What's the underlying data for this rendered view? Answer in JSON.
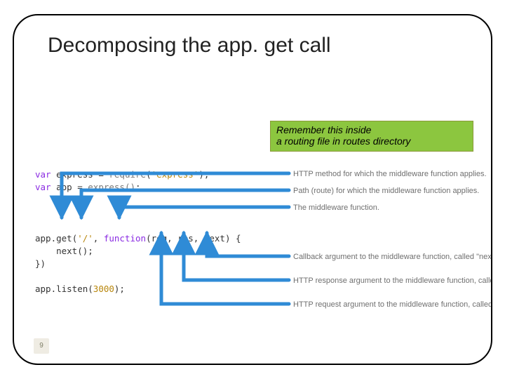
{
  "title": "Decomposing the app. get call",
  "callout": {
    "line1": "Remember this inside",
    "line2": "a routing file in routes directory"
  },
  "code": {
    "kw": "var",
    "express_id": "express",
    "express_rhs_fn": "require",
    "express_rhs_arg": "'express'",
    "app_id": "app",
    "app_rhs": "express()",
    "appget_obj": "app",
    "appget_method": "get",
    "appget_path": "'/'",
    "appget_fn_kw": "function",
    "appget_params": "(req, res, next)",
    "body_line": "    next();",
    "close_line": "})",
    "listen_line_obj": "app",
    "listen_line_method": "listen",
    "listen_port": "3000"
  },
  "labels": {
    "l1": "HTTP method for which the middleware function applies.",
    "l2": "Path (route) for which the middleware function applies.",
    "l3": "The middleware function.",
    "l4": "Callback argument to the middleware function, called \"next\" by convention.",
    "l5": "HTTP response argument to the middleware function, called \"res\" by convention.",
    "l6": "HTTP request argument to the middleware function, called \"req\" by convention."
  },
  "page_number": "9",
  "colors": {
    "accent_green": "#8cc63f",
    "arrow_blue": "#2f8bd6"
  }
}
